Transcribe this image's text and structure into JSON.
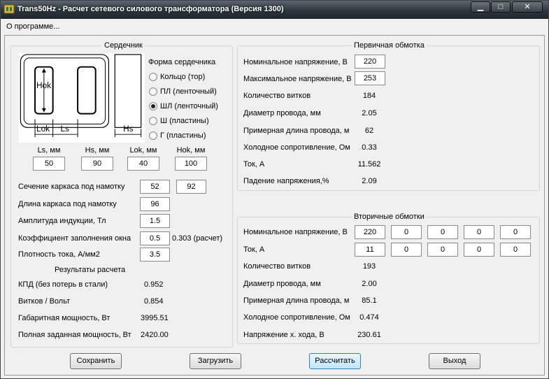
{
  "window": {
    "title": "Trans50Hz - Расчет сетевого силового трансформатора (Версия 1300)",
    "min_glyph": "▁",
    "max_glyph": "□",
    "close_glyph": "✕"
  },
  "menu": {
    "about": "О программе..."
  },
  "core": {
    "group_title": "Сердечник",
    "shape_title": "Форма сердечника",
    "shapes": [
      {
        "label": "Кольцо  (тор)",
        "checked": false
      },
      {
        "label": "ПЛ  (ленточный)",
        "checked": false
      },
      {
        "label": "ШЛ  (ленточный)",
        "checked": true
      },
      {
        "label": "Ш  (пластины)",
        "checked": false
      },
      {
        "label": "Г  (пластины)",
        "checked": false
      }
    ],
    "diagram_labels": {
      "hok": "Hok",
      "lok": "Lok",
      "ls": "Ls",
      "hs": "Hs"
    },
    "dims": [
      {
        "label": "Ls, мм",
        "value": "50"
      },
      {
        "label": "Hs, мм",
        "value": "90"
      },
      {
        "label": "Lok, мм",
        "value": "40"
      },
      {
        "label": "Hok, мм",
        "value": "100"
      }
    ],
    "frame_section_label": "Сечение каркаса под намотку",
    "frame_section_a": "52",
    "frame_section_b": "92",
    "frame_length_label": "Длина каркаса под намотку",
    "frame_length": "96",
    "induction_label": "Амплитуда индукции, Тл",
    "induction": "1.5",
    "fill_label": "Коэффициент заполнения окна",
    "fill": "0.5",
    "fill_calc": "0.303 (расчет)",
    "current_density_label": "Плотность тока, А/мм2",
    "current_density": "3.5",
    "results_title": "Результаты расчета",
    "results": [
      {
        "label": "КПД (без потерь в стали)",
        "value": "0.952"
      },
      {
        "label": "Витков / Вольт",
        "value": "0.854"
      },
      {
        "label": "Габаритная мощность, Вт",
        "value": "3995.51"
      },
      {
        "label": "Полная заданная мощность, Вт",
        "value": "2420.00"
      }
    ]
  },
  "primary": {
    "group_title": "Первичная обмотка",
    "nominal_voltage_label": "Номинальное напряжение, В",
    "nominal_voltage": "220",
    "max_voltage_label": "Максимальное напряжение, В",
    "max_voltage": "253",
    "rows": [
      {
        "label": "Количество витков",
        "value": "184"
      },
      {
        "label": "Диаметр провода, мм",
        "value": "2.05"
      },
      {
        "label": "Примерная длина провода, м",
        "value": "62"
      },
      {
        "label": "Холодное сопротивление, Ом",
        "value": "0.33"
      },
      {
        "label": "Ток, А",
        "value": "11.562"
      },
      {
        "label": "Падение напряжения,%",
        "value": "2.09"
      }
    ]
  },
  "secondary": {
    "group_title": "Вторичные обмотки",
    "voltage_label": "Номинальное напряжение, В",
    "voltages": [
      "220",
      "0",
      "0",
      "0",
      "0"
    ],
    "current_label": "Ток, А",
    "currents": [
      "11",
      "0",
      "0",
      "0",
      "0"
    ],
    "rows": [
      {
        "label": "Количество витков",
        "value": "193"
      },
      {
        "label": "Диаметр провода, мм",
        "value": "2.00"
      },
      {
        "label": "Примерная длина провода, м",
        "value": "85.1"
      },
      {
        "label": "Холодное сопротивление, Ом",
        "value": "0.474"
      },
      {
        "label": "Напряжение х. хода, В",
        "value": "230.61"
      }
    ]
  },
  "buttons": {
    "save": "Сохранить",
    "load": "Загрузить",
    "calculate": "Рассчитать",
    "exit": "Выход"
  }
}
